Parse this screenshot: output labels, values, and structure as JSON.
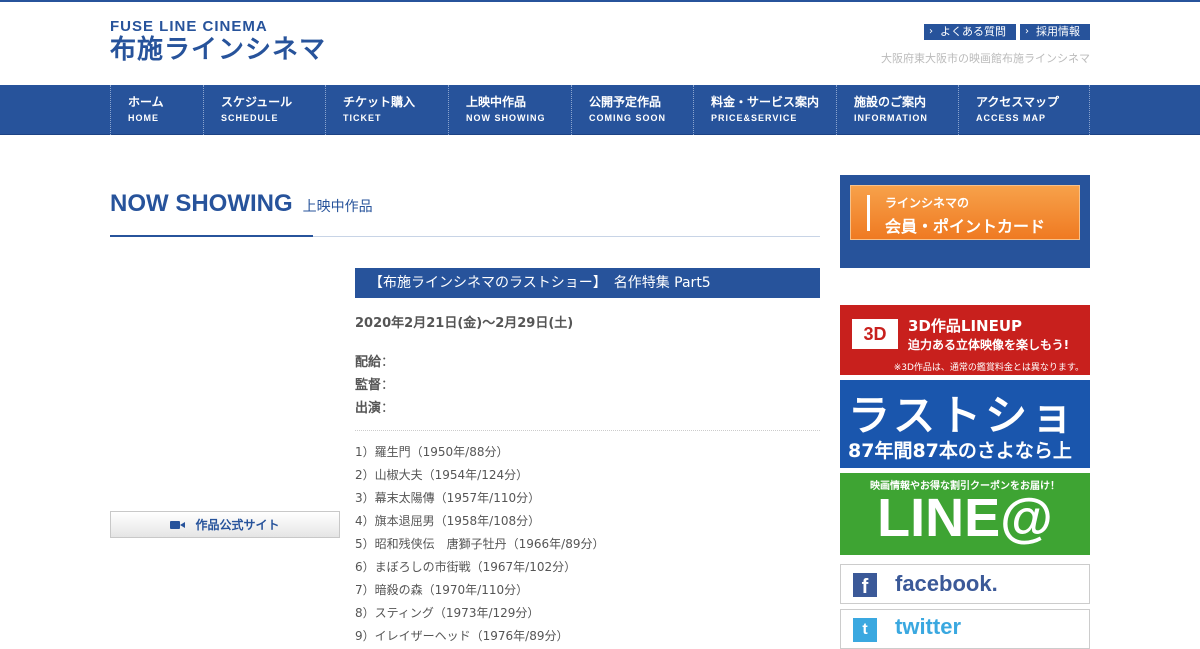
{
  "header": {
    "logo_en": "FUSE LINE CINEMA",
    "logo_ja": "布施ラインシネマ",
    "links": [
      "よくある質問",
      "採用情報"
    ],
    "tagline": "大阪府東大阪市の映画館布施ラインシネマ"
  },
  "nav": [
    {
      "ja": "ホーム",
      "en": "HOME"
    },
    {
      "ja": "スケジュール",
      "en": "SCHEDULE"
    },
    {
      "ja": "チケット購入",
      "en": "TICKET"
    },
    {
      "ja": "上映中作品",
      "en": "NOW SHOWING"
    },
    {
      "ja": "公開予定作品",
      "en": "COMING SOON"
    },
    {
      "ja": "料金・サービス案内",
      "en": "PRICE&SERVICE"
    },
    {
      "ja": "施設のご案内",
      "en": "INFORMATION"
    },
    {
      "ja": "アクセスマップ",
      "en": "ACCESS MAP"
    }
  ],
  "page": {
    "title_en": "NOW SHOWING",
    "title_ja": "上映中作品",
    "official_site_label": "作品公式サイト"
  },
  "movie": {
    "title": "【布施ラインシネマのラストショー】　名作特集 Part5",
    "dates": "2020年2月21日(金)～2月29日(土)",
    "meta_labels": [
      "配給",
      "監督",
      "出演"
    ],
    "films": [
      "1）羅生門（1950年/88分）",
      "2）山椒大夫（1954年/124分）",
      "3）幕末太陽傳（1957年/110分）",
      "4）旗本退屈男（1958年/108分）",
      "5）昭和残侠伝　唐獅子牡丹（1966年/89分）",
      "6）まぼろしの市街戦（1967年/102分）",
      "7）暗殺の森（1970年/110分）",
      "8）スティング（1973年/129分）",
      "9）イレイザーヘッド（1976年/89分）"
    ]
  },
  "sidebar": {
    "member_line1": "ラインシネマの",
    "member_line2": "会員・ポイントカード",
    "threed_badge": "3D",
    "threed_title": "3D作品LINEUP",
    "threed_sub": "迫力ある立体映像を楽しもう!",
    "threed_note": "※3D作品は、通常の鑑賞料金とは異なります。",
    "lastshow_title": "ラストショ",
    "lastshow_sub": "87年間87本のさよなら上",
    "line_sub": "映画情報やお得な割引クーポンをお届け！",
    "line_title": "LINE@",
    "facebook": "facebook.",
    "twitter": "twitter"
  },
  "colors": {
    "brand": "#27539b",
    "member_orange": "#ef7a22",
    "threed_red": "#c8201d",
    "line_green": "#3ea433"
  }
}
